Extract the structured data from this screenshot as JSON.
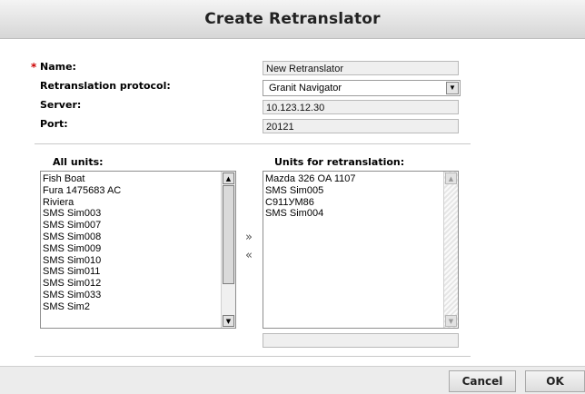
{
  "dialog": {
    "title": "Create Retranslator"
  },
  "form": {
    "required_mark": "*",
    "name_label": "Name:",
    "name_value": "New Retranslator",
    "protocol_label": "Retranslation protocol:",
    "protocol_value": "Granit Navigator",
    "server_label": "Server:",
    "server_value": "10.123.12.30",
    "port_label": "Port:",
    "port_value": "20121"
  },
  "units": {
    "all_label": "All units:",
    "all_items": [
      "Fish Boat",
      "Fura 1475683 AC",
      "Riviera",
      "SMS Sim003",
      "SMS Sim007",
      "SMS Sim008",
      "SMS Sim009",
      "SMS Sim010",
      "SMS Sim011",
      "SMS Sim012",
      "SMS Sim033",
      "SMS Sim2"
    ],
    "retranslation_label": "Units for retranslation:",
    "retranslation_items": [
      "Mazda 326 OA 1107",
      "SMS Sim005",
      "C911УМ86",
      "SMS Sim004"
    ],
    "add_symbol": "»",
    "remove_symbol": "«",
    "unit_id_value": ""
  },
  "footer": {
    "cancel_label": "Cancel",
    "ok_label": "OK"
  }
}
